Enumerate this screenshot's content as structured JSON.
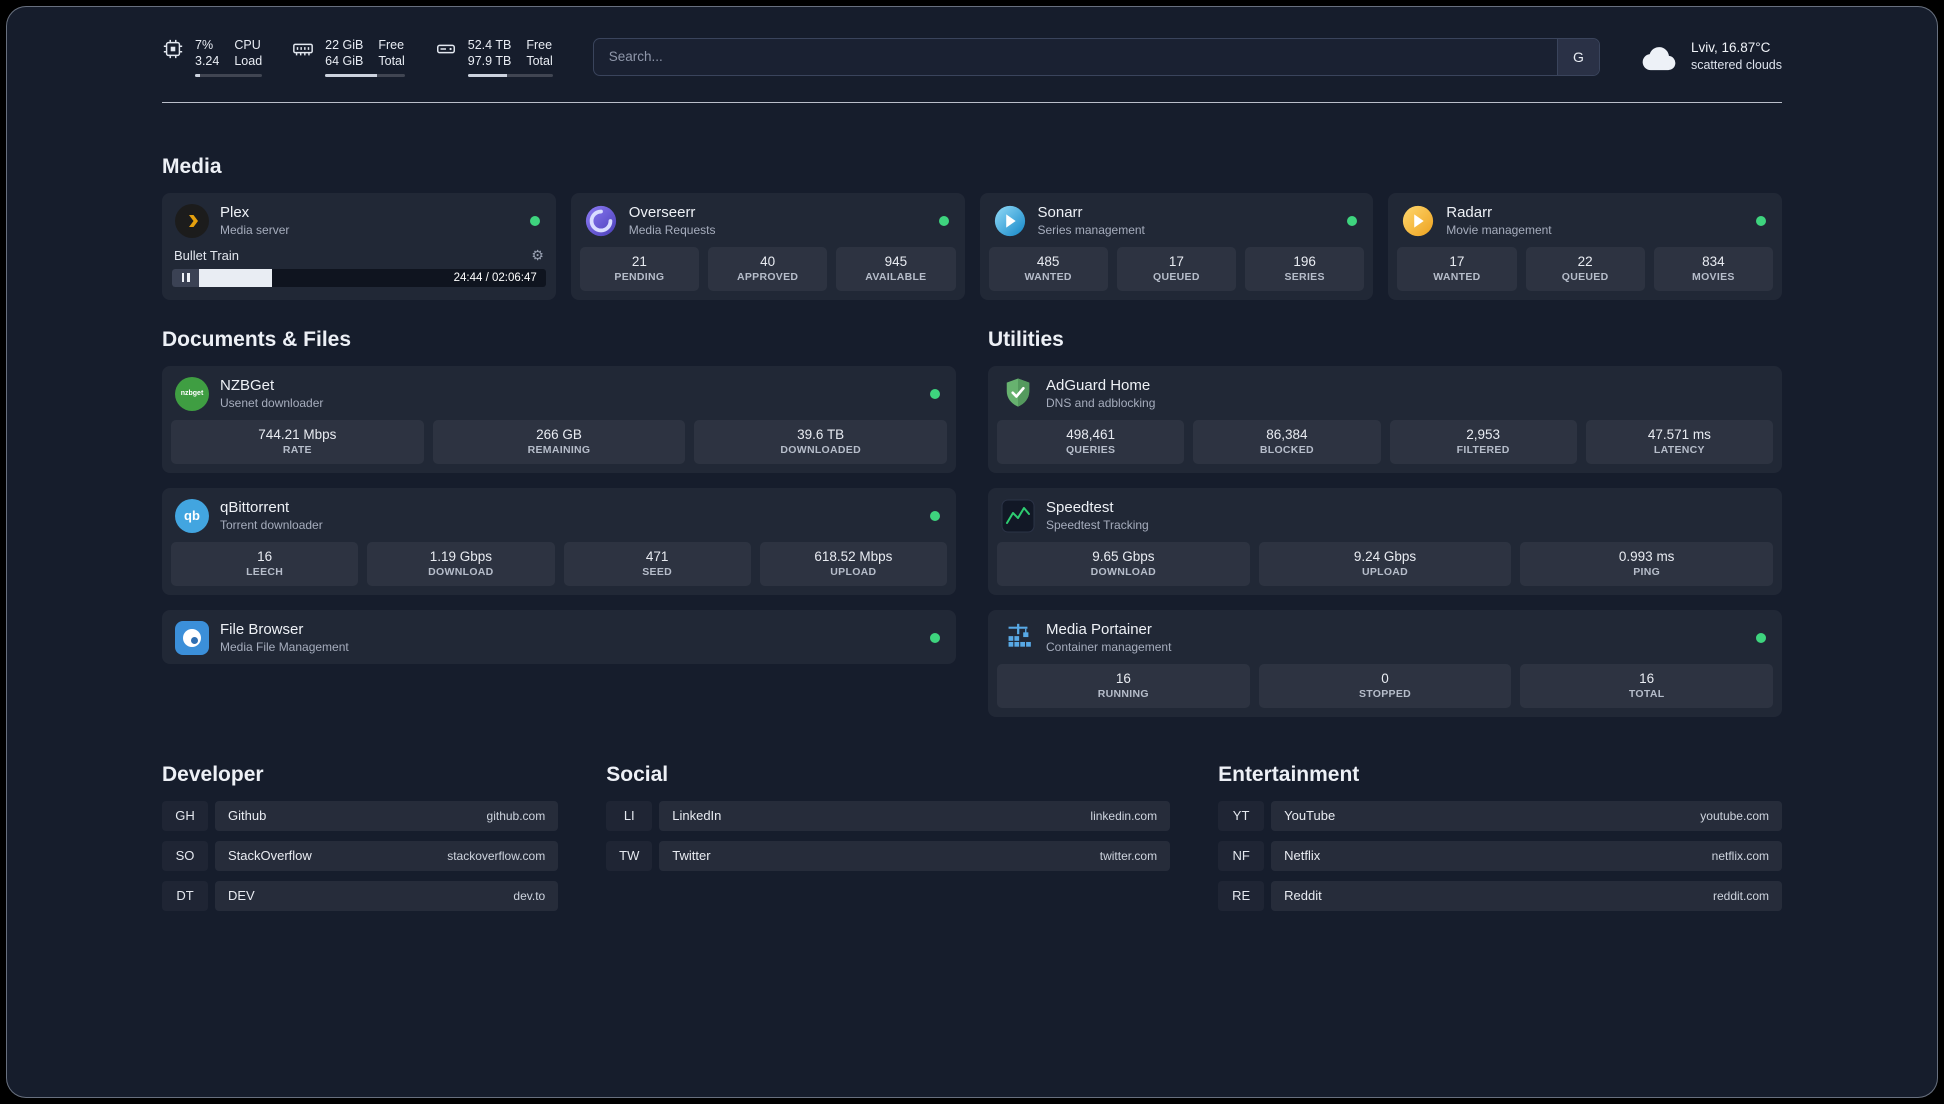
{
  "topbar": {
    "cpu": {
      "value": "7%",
      "load": "3.24",
      "labels": [
        "CPU",
        "Load"
      ],
      "bar_pct": 7
    },
    "memory": {
      "free": "22 GiB",
      "total": "64 GiB",
      "labels": [
        "Free",
        "Total"
      ],
      "bar_pct": 65.6
    },
    "disk": {
      "free": "52.4 TB",
      "total": "97.9 TB",
      "labels": [
        "Free",
        "Total"
      ],
      "bar_pct": 46.5
    },
    "search": {
      "placeholder": "Search...",
      "button_label": "G"
    },
    "weather": {
      "location": "Lviv, 16.87°C",
      "condition": "scattered clouds"
    }
  },
  "sections": {
    "media": {
      "title": "Media",
      "plex": {
        "name": "Plex",
        "description": "Media server",
        "now_playing": "Bullet Train",
        "time": "24:44 / 02:06:47",
        "progress_pct": 19.5
      },
      "overseerr": {
        "name": "Overseerr",
        "description": "Media Requests",
        "stats": [
          {
            "value": "21",
            "label": "PENDING"
          },
          {
            "value": "40",
            "label": "APPROVED"
          },
          {
            "value": "945",
            "label": "AVAILABLE"
          }
        ]
      },
      "sonarr": {
        "name": "Sonarr",
        "description": "Series management",
        "stats": [
          {
            "value": "485",
            "label": "WANTED"
          },
          {
            "value": "17",
            "label": "QUEUED"
          },
          {
            "value": "196",
            "label": "SERIES"
          }
        ]
      },
      "radarr": {
        "name": "Radarr",
        "description": "Movie management",
        "stats": [
          {
            "value": "17",
            "label": "WANTED"
          },
          {
            "value": "22",
            "label": "QUEUED"
          },
          {
            "value": "834",
            "label": "MOVIES"
          }
        ]
      }
    },
    "documents": {
      "title": "Documents & Files",
      "nzbget": {
        "name": "NZBGet",
        "description": "Usenet downloader",
        "stats": [
          {
            "value": "744.21 Mbps",
            "label": "RATE"
          },
          {
            "value": "266 GB",
            "label": "REMAINING"
          },
          {
            "value": "39.6 TB",
            "label": "DOWNLOADED"
          }
        ]
      },
      "qbittorrent": {
        "name": "qBittorrent",
        "description": "Torrent downloader",
        "stats": [
          {
            "value": "16",
            "label": "LEECH"
          },
          {
            "value": "1.19 Gbps",
            "label": "DOWNLOAD"
          },
          {
            "value": "471",
            "label": "SEED"
          },
          {
            "value": "618.52 Mbps",
            "label": "UPLOAD"
          }
        ]
      },
      "filebrowser": {
        "name": "File Browser",
        "description": "Media File Management"
      }
    },
    "utilities": {
      "title": "Utilities",
      "adguard": {
        "name": "AdGuard Home",
        "description": "DNS and adblocking",
        "stats": [
          {
            "value": "498,461",
            "label": "QUERIES"
          },
          {
            "value": "86,384",
            "label": "BLOCKED"
          },
          {
            "value": "2,953",
            "label": "FILTERED"
          },
          {
            "value": "47.571 ms",
            "label": "LATENCY"
          }
        ]
      },
      "speedtest": {
        "name": "Speedtest",
        "description": "Speedtest Tracking",
        "stats": [
          {
            "value": "9.65 Gbps",
            "label": "DOWNLOAD"
          },
          {
            "value": "9.24 Gbps",
            "label": "UPLOAD"
          },
          {
            "value": "0.993 ms",
            "label": "PING"
          }
        ]
      },
      "portainer": {
        "name": "Media Portainer",
        "description": "Container management",
        "stats": [
          {
            "value": "16",
            "label": "RUNNING"
          },
          {
            "value": "0",
            "label": "STOPPED"
          },
          {
            "value": "16",
            "label": "TOTAL"
          }
        ]
      }
    },
    "bookmarks": [
      {
        "title": "Developer",
        "links": [
          {
            "abbr": "GH",
            "name": "Github",
            "domain": "github.com"
          },
          {
            "abbr": "SO",
            "name": "StackOverflow",
            "domain": "stackoverflow.com"
          },
          {
            "abbr": "DT",
            "name": "DEV",
            "domain": "dev.to"
          }
        ]
      },
      {
        "title": "Social",
        "links": [
          {
            "abbr": "LI",
            "name": "LinkedIn",
            "domain": "linkedin.com"
          },
          {
            "abbr": "TW",
            "name": "Twitter",
            "domain": "twitter.com"
          }
        ]
      },
      {
        "title": "Entertainment",
        "links": [
          {
            "abbr": "YT",
            "name": "YouTube",
            "domain": "youtube.com"
          },
          {
            "abbr": "NF",
            "name": "Netflix",
            "domain": "netflix.com"
          },
          {
            "abbr": "RE",
            "name": "Reddit",
            "domain": "reddit.com"
          }
        ]
      }
    ]
  },
  "icons": {
    "nzbget_label": "nzbget",
    "qbittorrent_label": "qb",
    "gear": "⚙"
  },
  "colors": {
    "status_online": "#3ed47e",
    "plex_gold": "#e5a00d"
  }
}
